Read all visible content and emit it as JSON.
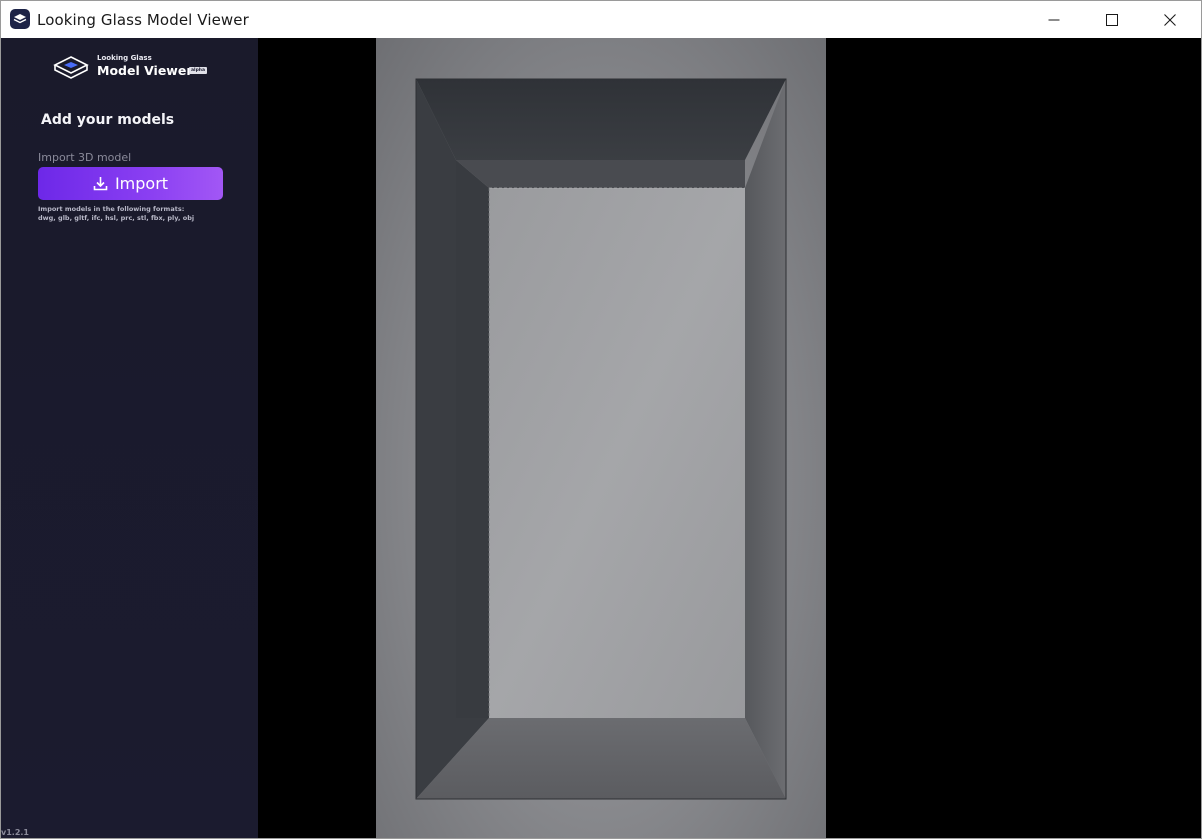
{
  "window": {
    "title": "Looking Glass Model Viewer"
  },
  "sidebar": {
    "logo": {
      "small": "Looking Glass",
      "big": "Model Viewer",
      "badge": "alpha"
    },
    "section_title": "Add your models",
    "import_label": "Import 3D model",
    "import_button": "Import",
    "formats_line1": "Import models in the following formats:",
    "formats_line2": "dwg, glb, gltf, ifc, hsl, prc, stl, fbx, ply, obj",
    "version": "v1.2.1"
  },
  "colors": {
    "sidebar_bg": "#1b1b2f",
    "accent": "#7c3aed",
    "viewport_bg": "#000000"
  },
  "icons": {
    "app": "looking-glass-app-icon",
    "logo": "looking-glass-logo-icon",
    "import": "download-icon",
    "minimize": "minimize-icon",
    "maximize": "maximize-icon",
    "close": "close-icon"
  }
}
